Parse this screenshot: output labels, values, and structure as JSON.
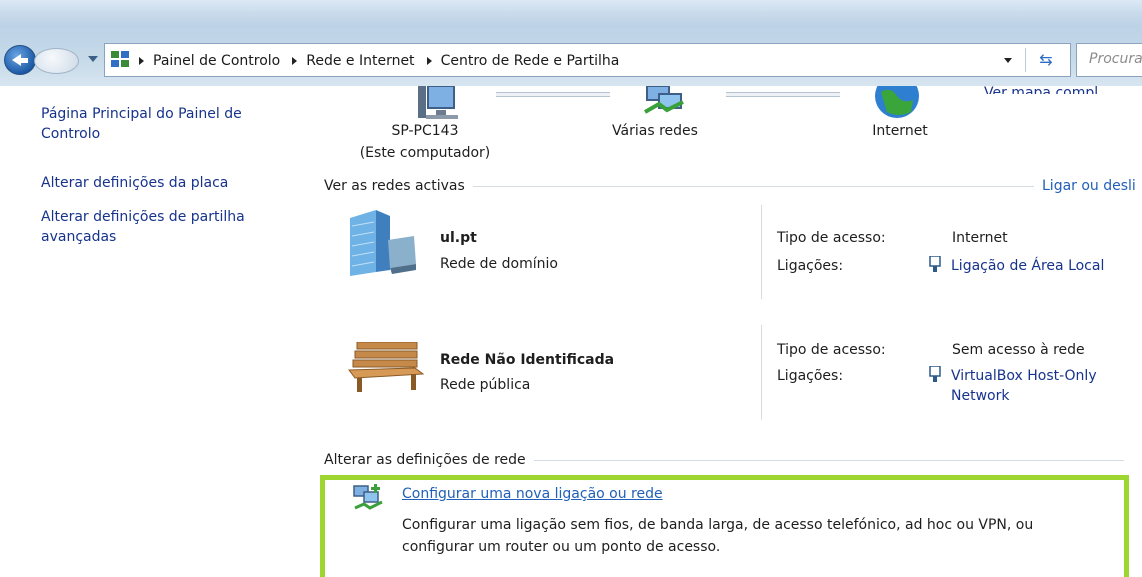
{
  "breadcrumbs": [
    "Painel de Controlo",
    "Rede e Internet",
    "Centro de Rede e Partilha"
  ],
  "search": {
    "placeholder": "Procurar"
  },
  "left_nav": {
    "items": [
      {
        "label": "Página Principal do Painel de Controlo"
      },
      {
        "label": "Alterar definições da placa"
      },
      {
        "label": "Alterar definições de partilha avançadas"
      }
    ]
  },
  "network_map": {
    "computer_name": "SP-PC143",
    "computer_sub": "(Este computador)",
    "middle": "Várias redes",
    "internet": "Internet",
    "full_map_link": "Ver mapa compl"
  },
  "active_networks": {
    "title": "Ver as redes activas",
    "connect_link": "Ligar ou desli",
    "access_type_label": "Tipo de acesso:",
    "connections_label": "Ligações:",
    "networks": [
      {
        "name": "ul.pt",
        "category": "Rede de domínio",
        "access": "Internet",
        "connection": "Ligação de Área Local"
      },
      {
        "name": "Rede Não Identificada",
        "category": "Rede pública",
        "access": "Sem acesso à rede",
        "connection_l1": "VirtualBox Host-Only",
        "connection_l2": "Network"
      }
    ]
  },
  "change_settings": {
    "title": "Alterar as definições de rede",
    "task_link": "Configurar uma nova ligação ou rede",
    "task_desc": "Configurar uma ligação sem fios, de banda larga, de acesso telefónico, ad hoc ou VPN, ou configurar um router ou um ponto de acesso."
  },
  "colors": {
    "link": "#17338c",
    "highlight_border": "#9ed630"
  }
}
